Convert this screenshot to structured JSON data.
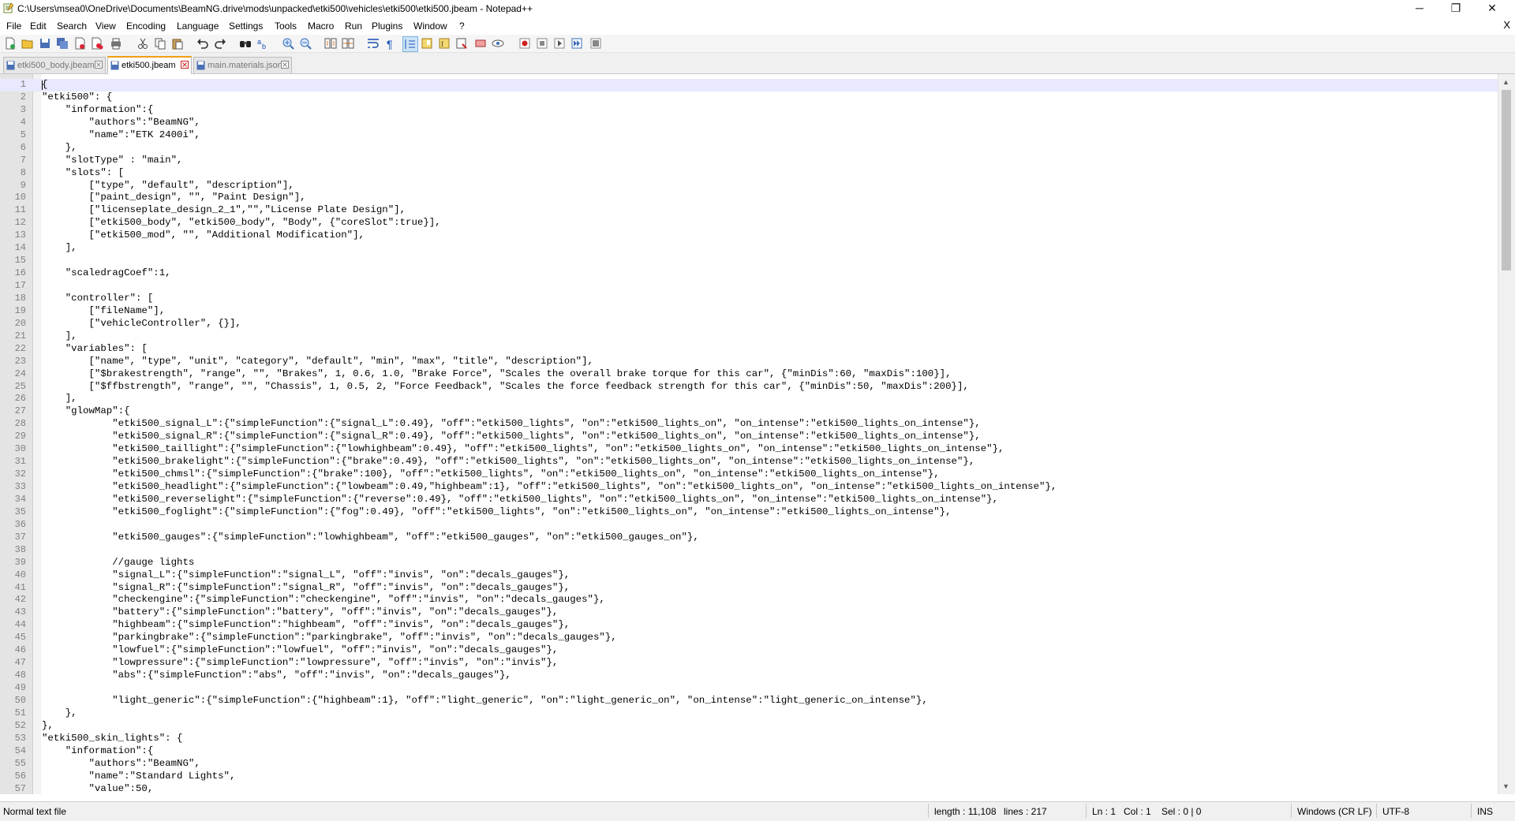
{
  "window": {
    "title": "C:\\Users\\msea0\\OneDrive\\Documents\\BeamNG.drive\\mods\\unpacked\\etki500\\vehicles\\etki500\\etki500.jbeam - Notepad++",
    "minimize": "─",
    "restore": "❐",
    "close": "✕"
  },
  "menu": {
    "items": [
      "File",
      "Edit",
      "Search",
      "View",
      "Encoding",
      "Language",
      "Settings",
      "Tools",
      "Macro",
      "Run",
      "Plugins",
      "Window",
      "?"
    ],
    "close_document": "X"
  },
  "toolbar": {
    "icons": [
      "new-file-icon",
      "open-file-icon",
      "save-icon",
      "save-all-icon",
      "close-icon",
      "close-all-icon",
      "print-icon",
      "cut-icon",
      "copy-icon",
      "paste-icon",
      "undo-icon",
      "redo-icon",
      "find-icon",
      "replace-icon",
      "zoom-in-icon",
      "zoom-out-icon",
      "sync-vertical-icon",
      "sync-horizontal-icon",
      "word-wrap-icon",
      "show-all-characters-icon",
      "indent-guide-icon",
      "document-map-icon",
      "function-list-icon",
      "folder-workspace-icon",
      "monitoring-icon",
      "macro-record-icon",
      "macro-stop-icon",
      "macro-play-icon",
      "macro-play-multiple-icon",
      "macro-save-icon"
    ]
  },
  "tabs": [
    {
      "label": "etki500_body.jbeam",
      "active": false
    },
    {
      "label": "etki500.jbeam",
      "active": true
    },
    {
      "label": "main.materials.json",
      "active": false
    }
  ],
  "editor": {
    "current_line": 1,
    "lines": [
      "{",
      "\"etki500\": {",
      "    \"information\":{",
      "        \"authors\":\"BeamNG\",",
      "        \"name\":\"ETK 2400i\",",
      "    },",
      "    \"slotType\" : \"main\",",
      "    \"slots\": [",
      "        [\"type\", \"default\", \"description\"],",
      "        [\"paint_design\", \"\", \"Paint Design\"],",
      "        [\"licenseplate_design_2_1\",\"\",\"License Plate Design\"],",
      "        [\"etki500_body\", \"etki500_body\", \"Body\", {\"coreSlot\":true}],",
      "        [\"etki500_mod\", \"\", \"Additional Modification\"],",
      "    ],",
      "",
      "    \"scaledragCoef\":1,",
      "",
      "    \"controller\": [",
      "        [\"fileName\"],",
      "        [\"vehicleController\", {}],",
      "    ],",
      "    \"variables\": [",
      "        [\"name\", \"type\", \"unit\", \"category\", \"default\", \"min\", \"max\", \"title\", \"description\"],",
      "        [\"$brakestrength\", \"range\", \"\", \"Brakes\", 1, 0.6, 1.0, \"Brake Force\", \"Scales the overall brake torque for this car\", {\"minDis\":60, \"maxDis\":100}],",
      "        [\"$ffbstrength\", \"range\", \"\", \"Chassis\", 1, 0.5, 2, \"Force Feedback\", \"Scales the force feedback strength for this car\", {\"minDis\":50, \"maxDis\":200}],",
      "    ],",
      "    \"glowMap\":{",
      "            \"etki500_signal_L\":{\"simpleFunction\":{\"signal_L\":0.49}, \"off\":\"etki500_lights\", \"on\":\"etki500_lights_on\", \"on_intense\":\"etki500_lights_on_intense\"},",
      "            \"etki500_signal_R\":{\"simpleFunction\":{\"signal_R\":0.49}, \"off\":\"etki500_lights\", \"on\":\"etki500_lights_on\", \"on_intense\":\"etki500_lights_on_intense\"},",
      "            \"etki500_taillight\":{\"simpleFunction\":{\"lowhighbeam\":0.49}, \"off\":\"etki500_lights\", \"on\":\"etki500_lights_on\", \"on_intense\":\"etki500_lights_on_intense\"},",
      "            \"etki500_brakelight\":{\"simpleFunction\":{\"brake\":0.49}, \"off\":\"etki500_lights\", \"on\":\"etki500_lights_on\", \"on_intense\":\"etki500_lights_on_intense\"},",
      "            \"etki500_chmsl\":{\"simpleFunction\":{\"brake\":100}, \"off\":\"etki500_lights\", \"on\":\"etki500_lights_on\", \"on_intense\":\"etki500_lights_on_intense\"},",
      "            \"etki500_headlight\":{\"simpleFunction\":{\"lowbeam\":0.49,\"highbeam\":1}, \"off\":\"etki500_lights\", \"on\":\"etki500_lights_on\", \"on_intense\":\"etki500_lights_on_intense\"},",
      "            \"etki500_reverselight\":{\"simpleFunction\":{\"reverse\":0.49}, \"off\":\"etki500_lights\", \"on\":\"etki500_lights_on\", \"on_intense\":\"etki500_lights_on_intense\"},",
      "            \"etki500_foglight\":{\"simpleFunction\":{\"fog\":0.49}, \"off\":\"etki500_lights\", \"on\":\"etki500_lights_on\", \"on_intense\":\"etki500_lights_on_intense\"},",
      "",
      "            \"etki500_gauges\":{\"simpleFunction\":\"lowhighbeam\", \"off\":\"etki500_gauges\", \"on\":\"etki500_gauges_on\"},",
      "",
      "            //gauge lights",
      "            \"signal_L\":{\"simpleFunction\":\"signal_L\", \"off\":\"invis\", \"on\":\"decals_gauges\"},",
      "            \"signal_R\":{\"simpleFunction\":\"signal_R\", \"off\":\"invis\", \"on\":\"decals_gauges\"},",
      "            \"checkengine\":{\"simpleFunction\":\"checkengine\", \"off\":\"invis\", \"on\":\"decals_gauges\"},",
      "            \"battery\":{\"simpleFunction\":\"battery\", \"off\":\"invis\", \"on\":\"decals_gauges\"},",
      "            \"highbeam\":{\"simpleFunction\":\"highbeam\", \"off\":\"invis\", \"on\":\"decals_gauges\"},",
      "            \"parkingbrake\":{\"simpleFunction\":\"parkingbrake\", \"off\":\"invis\", \"on\":\"decals_gauges\"},",
      "            \"lowfuel\":{\"simpleFunction\":\"lowfuel\", \"off\":\"invis\", \"on\":\"decals_gauges\"},",
      "            \"lowpressure\":{\"simpleFunction\":\"lowpressure\", \"off\":\"invis\", \"on\":\"invis\"},",
      "            \"abs\":{\"simpleFunction\":\"abs\", \"off\":\"invis\", \"on\":\"decals_gauges\"},",
      "",
      "            \"light_generic\":{\"simpleFunction\":{\"highbeam\":1}, \"off\":\"light_generic\", \"on\":\"light_generic_on\", \"on_intense\":\"light_generic_on_intense\"},",
      "    },",
      "},",
      "\"etki500_skin_lights\": {",
      "    \"information\":{",
      "        \"authors\":\"BeamNG\",",
      "        \"name\":\"Standard Lights\",",
      "        \"value\":50,"
    ]
  },
  "statusbar": {
    "file_type": "Normal text file",
    "length": "length : 11,108",
    "lines": "lines : 217",
    "ln": "Ln : 1",
    "col": "Col : 1",
    "sel": "Sel : 0 | 0",
    "eol": "Windows (CR LF)",
    "encoding": "UTF-8",
    "mode": "INS"
  },
  "colors": {
    "accent_tab": "#f0a010",
    "current_line": "#e8e8ff",
    "gutter": "#e4e4e4"
  }
}
